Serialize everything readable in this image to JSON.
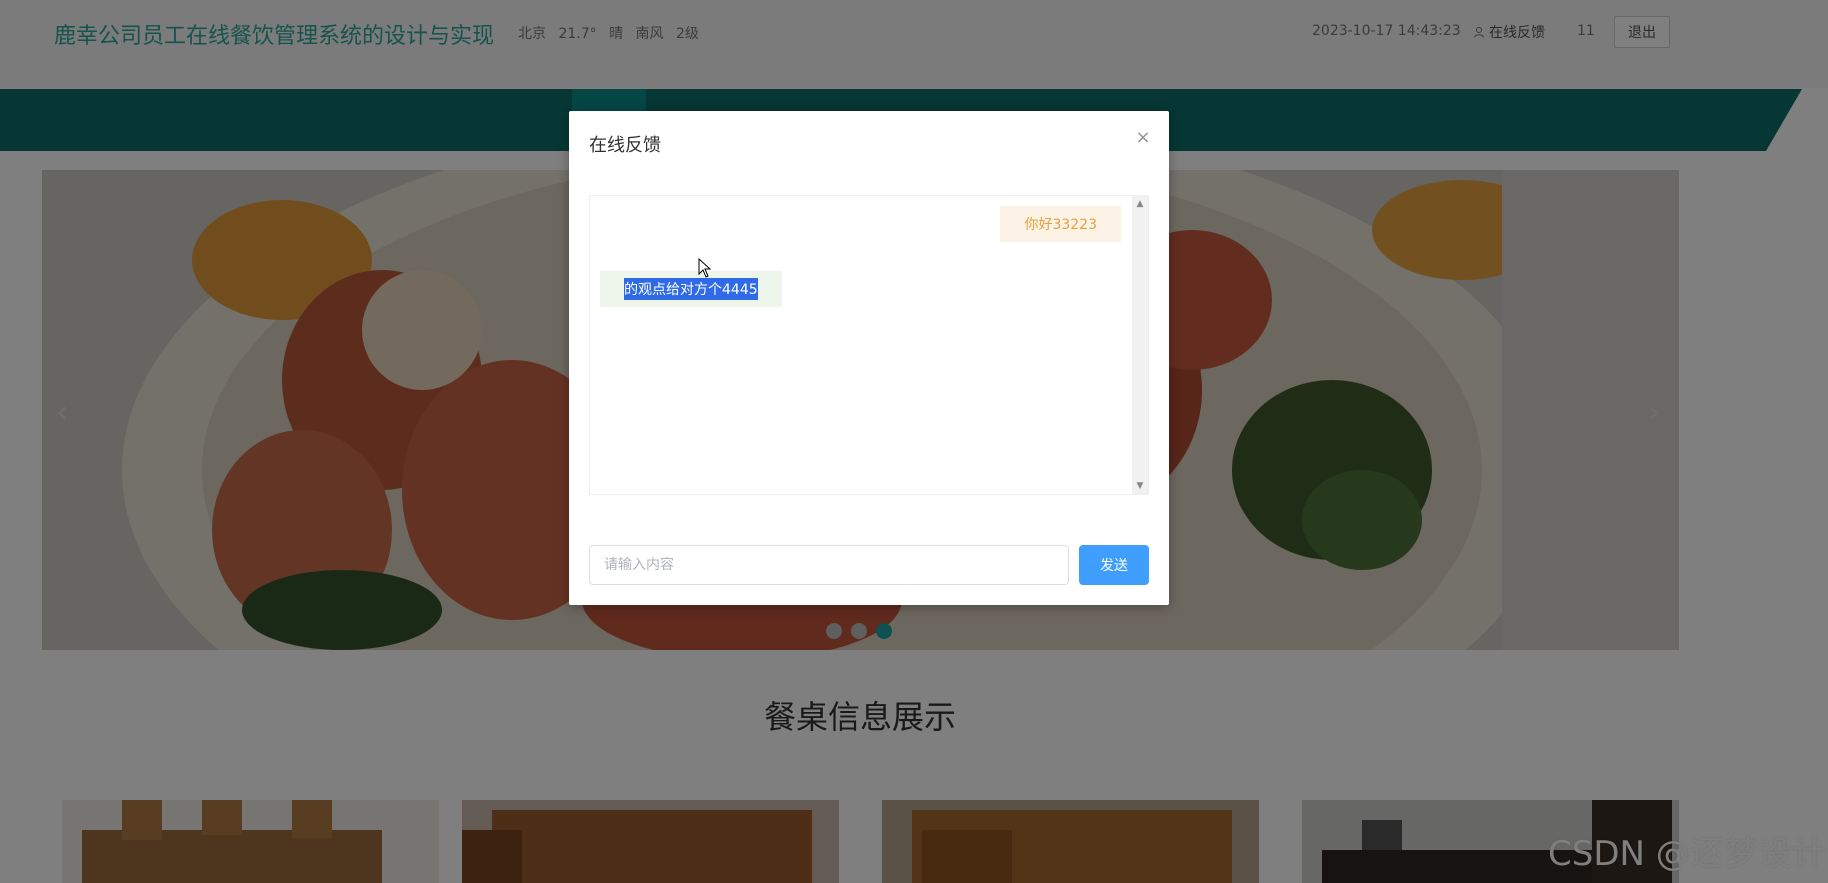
{
  "header": {
    "site_title": "鹿幸公司员工在线餐饮管理系统的设计与实现",
    "weather": {
      "city": "北京",
      "temp": "21.7°",
      "condition": "晴",
      "wind": "南风",
      "wind_level": "2级"
    },
    "datetime": "2023-10-17 14:43:23",
    "feedback_link": "在线反馈",
    "username": "11",
    "logout_label": "退出",
    "icons": {
      "feedback": "user-icon"
    }
  },
  "nav": {
    "color": "#0d6f6b",
    "active_color": "#0a8e8a"
  },
  "carousel": {
    "prev_arrow": "‹",
    "next_arrow": "›",
    "dots": [
      false,
      false,
      true
    ]
  },
  "section": {
    "title": "餐桌信息展示"
  },
  "watermark": "CSDN @逐梦设计",
  "modal": {
    "title": "在线反馈",
    "close": "×",
    "messages": [
      {
        "side": "right",
        "text": "你好33223"
      },
      {
        "side": "left",
        "text": "的观点给对方个4445"
      }
    ],
    "input": {
      "placeholder": "请输入内容",
      "value": ""
    },
    "send_label": "发送",
    "colors": {
      "send_button": "#409eff",
      "right_bubble": "#fdf2e6",
      "left_bubble": "#eef6ec"
    }
  }
}
